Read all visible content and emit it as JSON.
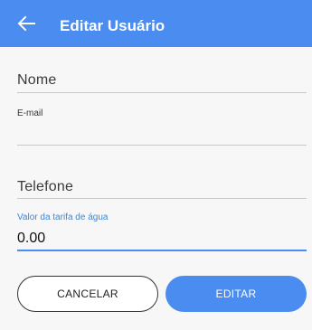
{
  "appbar": {
    "title": "Editar Usuário",
    "back_icon": "arrow-left-icon",
    "color": "#4a8cf0"
  },
  "form": {
    "nome": {
      "placeholder": "Nome",
      "value": ""
    },
    "email": {
      "label": "E-mail",
      "value": ""
    },
    "telefone": {
      "placeholder": "Telefone",
      "value": ""
    },
    "tarifa": {
      "label": "Valor da tarifa de água",
      "value": "0.00"
    }
  },
  "buttons": {
    "cancel_label": "CANCELAR",
    "edit_label": "EDITAR"
  }
}
